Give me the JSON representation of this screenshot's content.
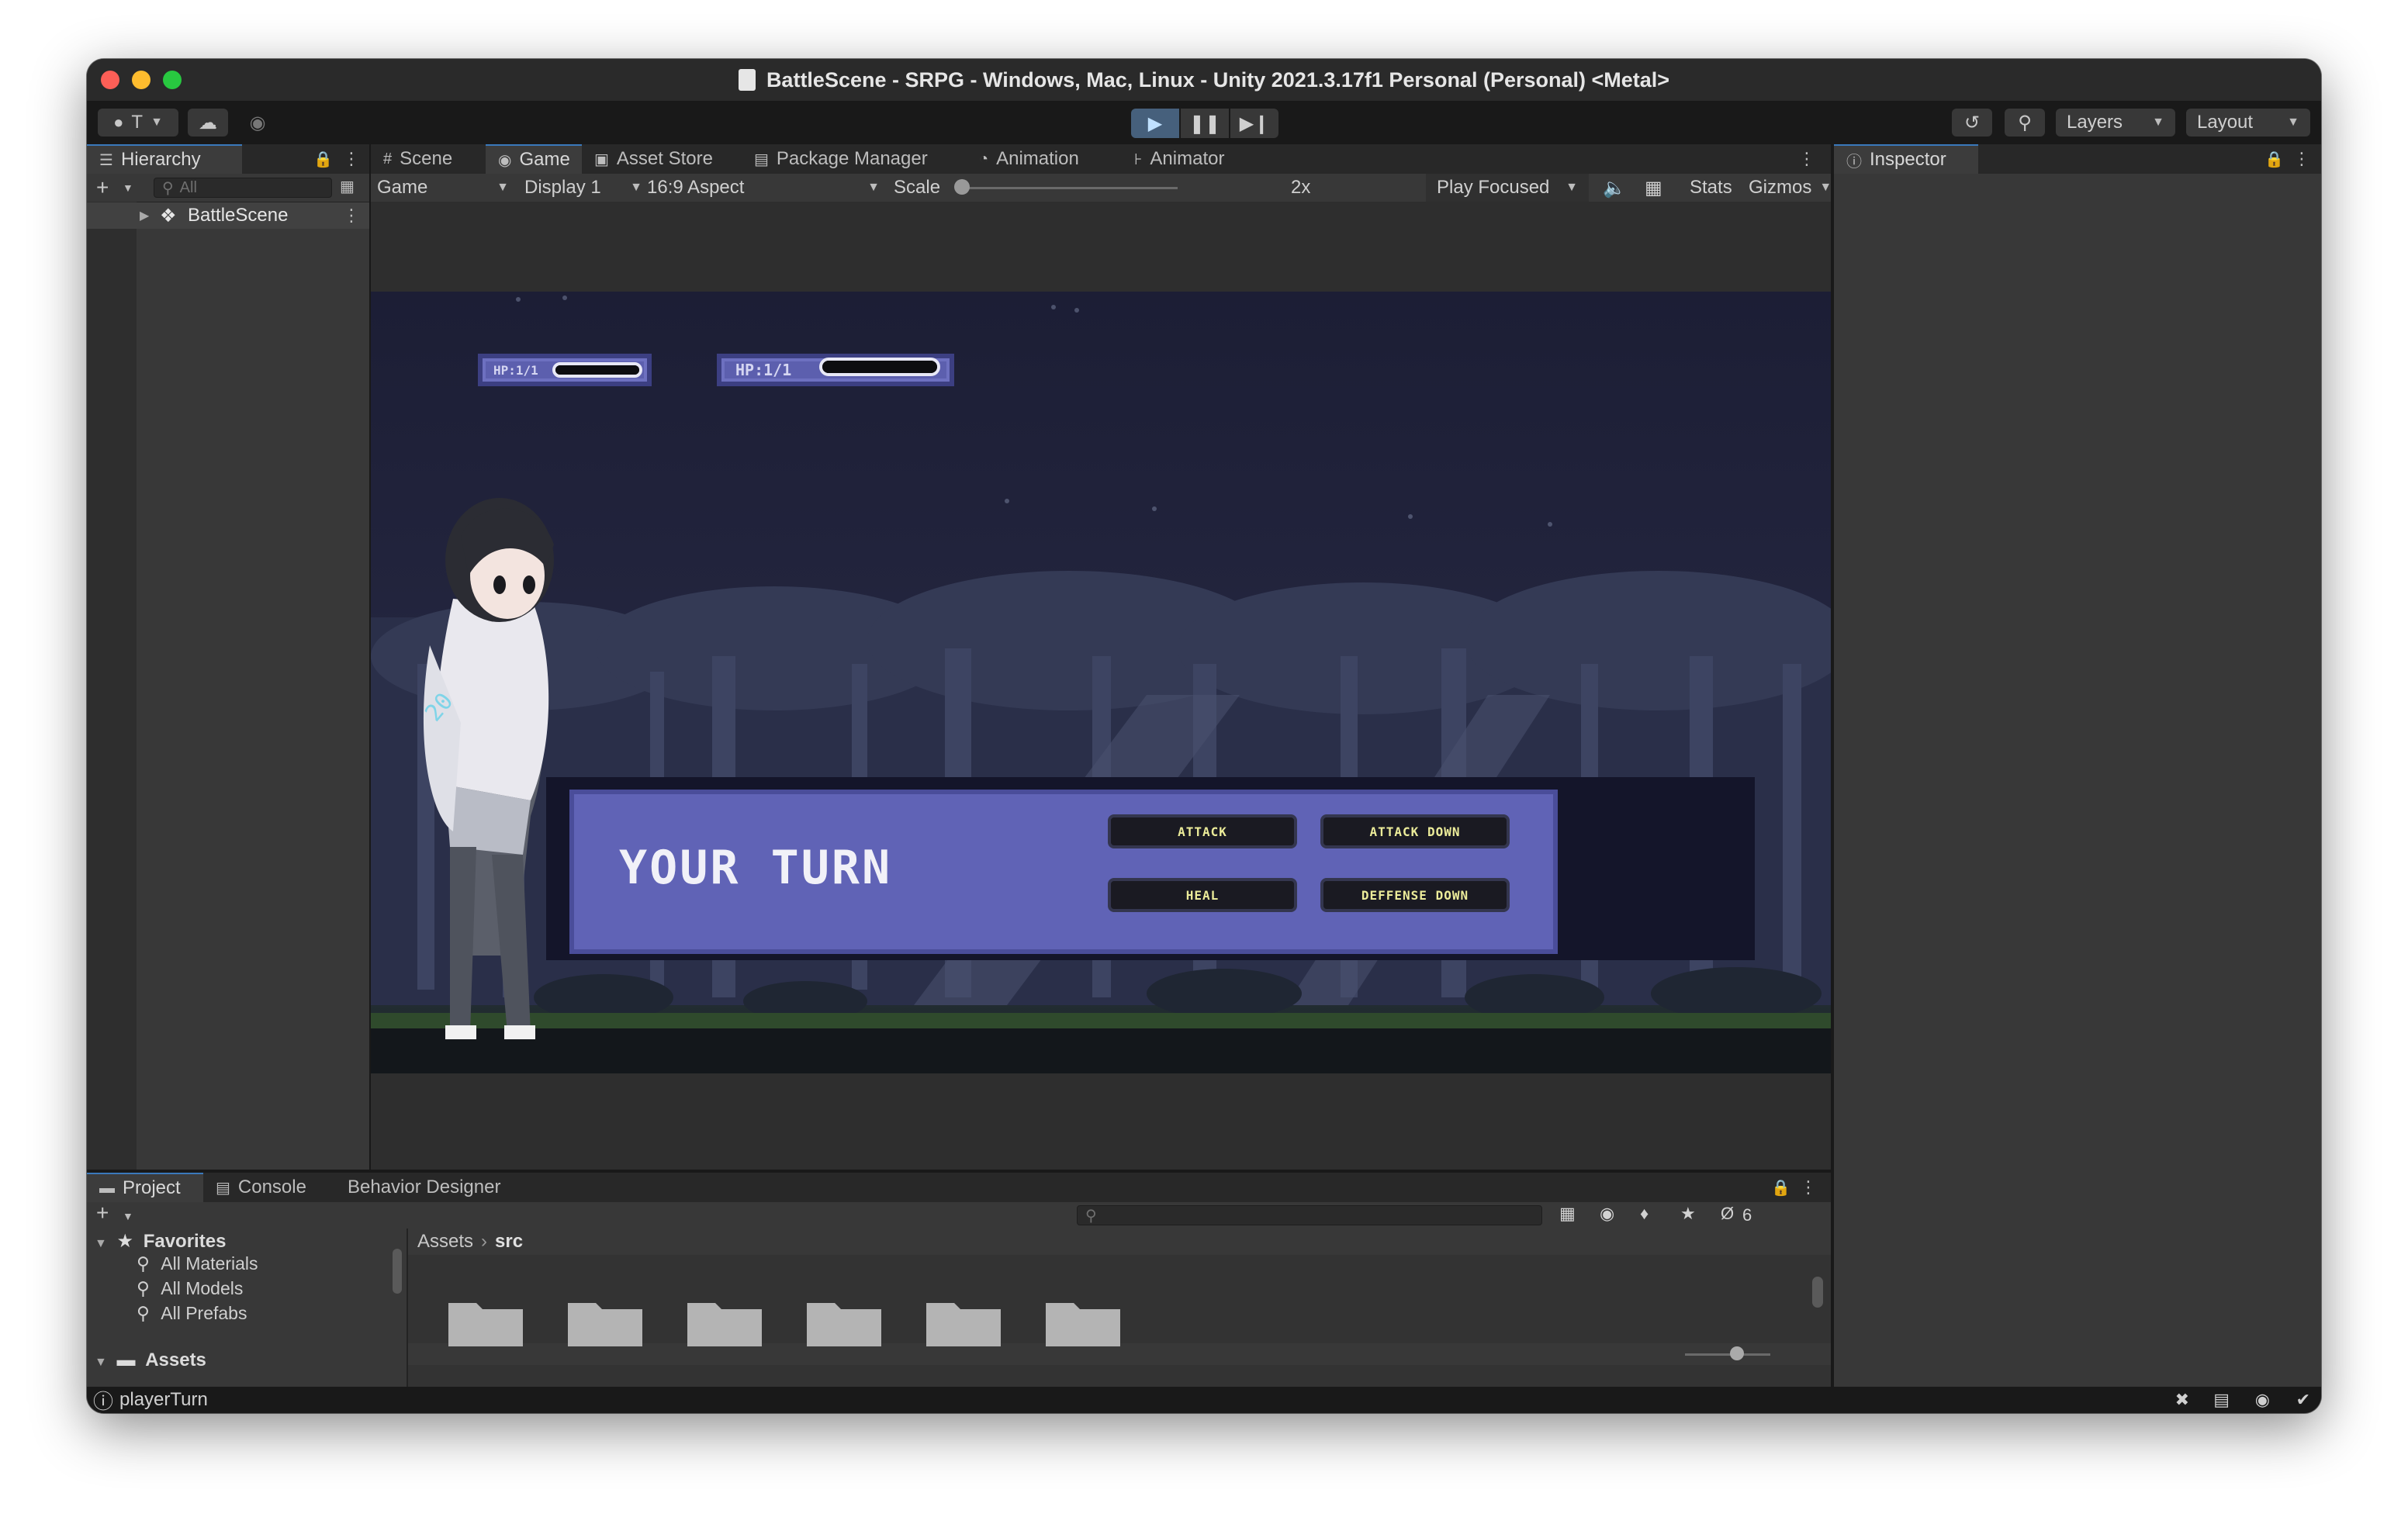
{
  "window": {
    "title": "BattleScene - SRPG - Windows, Mac, Linux - Unity 2021.3.17f1 Personal (Personal) <Metal>"
  },
  "toolbar": {
    "account_label": "T",
    "layers_label": "Layers",
    "layout_label": "Layout"
  },
  "hierarchy": {
    "tab_label": "Hierarchy",
    "search_placeholder": "All",
    "scene_name": "BattleScene"
  },
  "center_tabs": [
    {
      "label": "Scene"
    },
    {
      "label": "Game"
    },
    {
      "label": "Asset Store"
    },
    {
      "label": "Package Manager"
    },
    {
      "label": "Animation"
    },
    {
      "label": "Animator"
    }
  ],
  "game_toolbar": {
    "view_mode": "Game",
    "display": "Display 1",
    "aspect": "16:9 Aspect",
    "scale_label": "Scale",
    "scale_value": "2x",
    "play_mode": "Play Focused",
    "stats_label": "Stats",
    "gizmos_label": "Gizmos"
  },
  "game": {
    "hp_left": "HP:1/1",
    "hp_right": "HP:1/1",
    "turn_text": "YOUR TURN",
    "actions": [
      "ATTACK",
      "ATTACK DOWN",
      "HEAL",
      "DEFFENSE DOWN"
    ]
  },
  "inspector": {
    "tab_label": "Inspector"
  },
  "bottom": {
    "tabs": [
      {
        "label": "Project"
      },
      {
        "label": "Console"
      },
      {
        "label": "Behavior Designer"
      }
    ],
    "favorites_label": "Favorites",
    "favorites": [
      "All Materials",
      "All Models",
      "All Prefabs"
    ],
    "assets_label": "Assets",
    "breadcrumb_root": "Assets",
    "breadcrumb_current": "src",
    "hidden_count": "6"
  },
  "status": {
    "message": "playerTurn"
  },
  "colors": {
    "accent": "#3a79bb",
    "panel_dark": "#191919",
    "panel": "#282828",
    "game_ui_panel": "#6063b6",
    "game_button_text": "#ecec9a"
  }
}
